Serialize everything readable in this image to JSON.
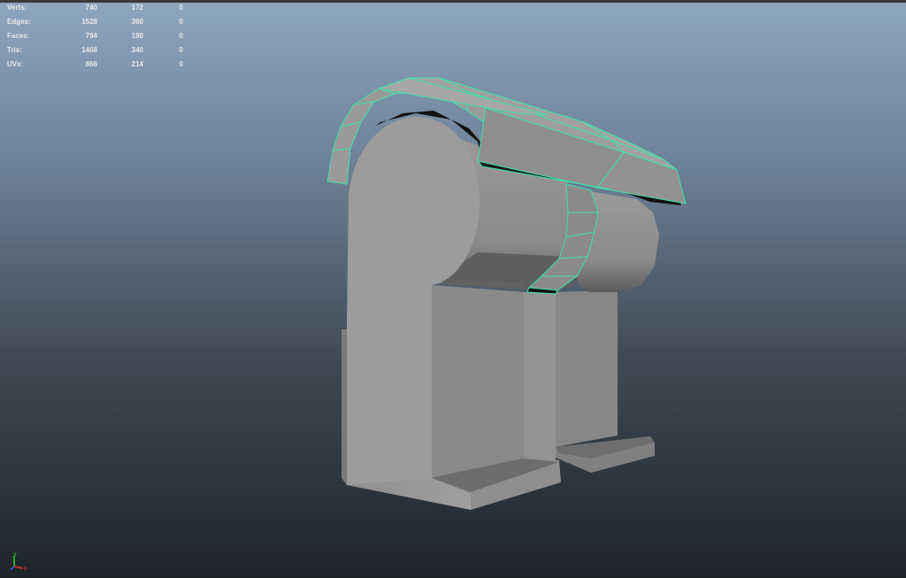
{
  "hud": {
    "rows": [
      {
        "label": "Verts:",
        "total": "740",
        "selected": "172",
        "third": "0"
      },
      {
        "label": "Edges:",
        "total": "1528",
        "selected": "360",
        "third": "0"
      },
      {
        "label": "Faces:",
        "total": "794",
        "selected": "190",
        "third": "0"
      },
      {
        "label": "Tris:",
        "total": "1468",
        "selected": "340",
        "third": "0"
      },
      {
        "label": "UVs:",
        "total": "866",
        "selected": "214",
        "third": "0"
      }
    ]
  },
  "axis": {
    "y": "y",
    "x": "x"
  },
  "colors": {
    "selection": "#3fe0a8",
    "mesh": "#8c8c8c",
    "axis_x": "#e03030",
    "axis_y": "#30d030",
    "axis_z": "#3060ff"
  }
}
